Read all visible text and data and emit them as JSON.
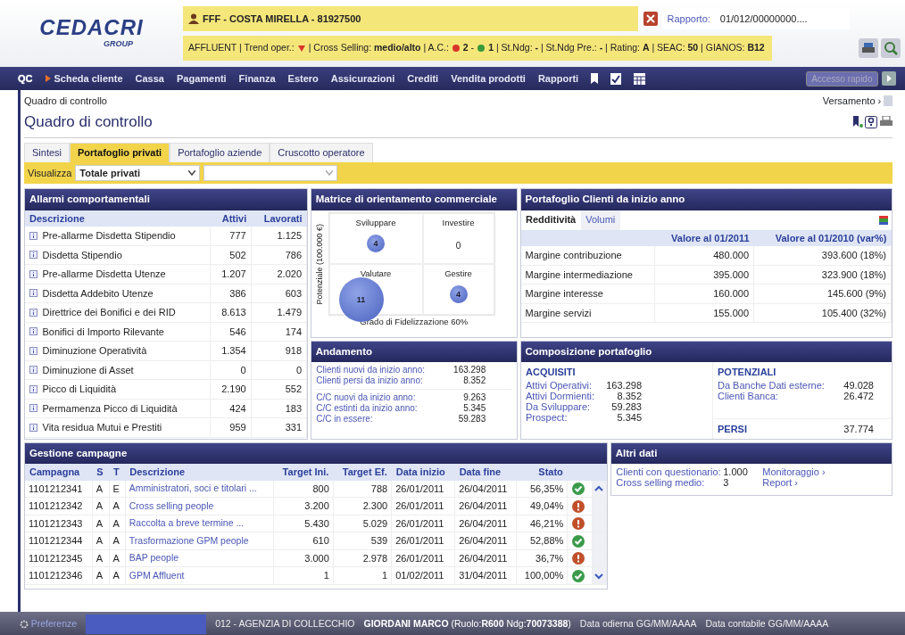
{
  "header": {
    "logo": "CEDACRI",
    "logo_sub": "GROUP",
    "client": "FFF - COSTA MIRELLA - 81927500",
    "rapporto_label": "Rapporto:",
    "rapporto_value": "01/012/00000000....",
    "info_segments": [
      {
        "kind": "text",
        "text": "AFFLUENT | Trend oper.:"
      },
      {
        "kind": "arrow",
        "color": "#d9352b"
      },
      {
        "kind": "text",
        "text": "| Cross Selling: **medio/alto** | A.C.:"
      },
      {
        "kind": "dot",
        "color": "#d9352b"
      },
      {
        "kind": "text",
        "text": "**2** -"
      },
      {
        "kind": "dot",
        "color": "#3a9a3a"
      },
      {
        "kind": "text",
        "text": "**1** | St.Ndg: **-** | St.Ndg Pre.: **-** | Rating: **A** | SEAC: **50** | GIANOS: **B12**"
      }
    ]
  },
  "nav": {
    "items": [
      {
        "label": "QC",
        "selected": true
      },
      {
        "label": "Scheda cliente",
        "selected": false
      },
      {
        "label": "Cassa",
        "selected": false
      },
      {
        "label": "Pagamenti",
        "selected": false
      },
      {
        "label": "Finanza",
        "selected": false
      },
      {
        "label": "Estero",
        "selected": false
      },
      {
        "label": "Assicurazioni",
        "selected": false
      },
      {
        "label": "Crediti",
        "selected": false
      },
      {
        "label": "Vendita prodotti",
        "selected": false
      },
      {
        "label": "Rapporti",
        "selected": false
      }
    ],
    "quick_access": "Accesso rapido"
  },
  "breadcrumb": "Quadro di controllo",
  "page_title": "Quadro di controllo",
  "versamento": "Versamento ›",
  "tabs": [
    {
      "label": "Sintesi",
      "selected": false
    },
    {
      "label": "Portafoglio privati",
      "selected": true
    },
    {
      "label": "Portafoglio aziende",
      "selected": false
    },
    {
      "label": "Cruscotto operatore",
      "selected": false
    }
  ],
  "filter": {
    "label": "Visualizza",
    "value": "Totale privati"
  },
  "alarms": {
    "title": "Allarmi comportamentali",
    "columns": [
      "Descrizione",
      "Attivi",
      "Lavorati"
    ],
    "rows": [
      [
        "Pre-allarme Disdetta Stipendio",
        "777",
        "1.125"
      ],
      [
        "Disdetta Stipendio",
        "502",
        "786"
      ],
      [
        "Pre-allarme Disdetta Utenze",
        "1.207",
        "2.020"
      ],
      [
        "Disdetta Addebito Utenze",
        "386",
        "603"
      ],
      [
        "Direttrice dei Bonifici e dei RID",
        "8.613",
        "1.479"
      ],
      [
        "Bonifici di Importo Rilevante",
        "546",
        "174"
      ],
      [
        "Diminuzione Operatività",
        "1.354",
        "918"
      ],
      [
        "Diminuzione di Asset",
        "0",
        "0"
      ],
      [
        "Picco di Liquidità",
        "2.190",
        "552"
      ],
      [
        "Permamenza Picco di Liquidità",
        "424",
        "183"
      ],
      [
        "Vita residua Mutui e Prestiti",
        "959",
        "331"
      ]
    ]
  },
  "matrix": {
    "title": "Matrice di orientamento commerciale",
    "ylabel": "Potenziale (100.000 €)",
    "xlabel": "Grado di Fidelizzazione 60%",
    "quadrants": [
      {
        "label": "Sviluppare",
        "count": "4",
        "kind": "small"
      },
      {
        "label": "Investire",
        "count": "0",
        "kind": "none"
      },
      {
        "label": "Valutare",
        "count": "11",
        "kind": "large"
      },
      {
        "label": "Gestire",
        "count": "4",
        "kind": "small"
      }
    ]
  },
  "trend": {
    "title": "Andamento",
    "groups": [
      [
        [
          "Clienti nuovi da inizio anno:",
          "163.298"
        ],
        [
          "Clienti persi da inizio anno:",
          "8.352"
        ]
      ],
      [
        [
          "C/C nuovi da inizio anno:",
          "9.263"
        ],
        [
          "C/C estinti da inizio anno:",
          "5.345"
        ],
        [
          "C/C in essere:",
          "59.283"
        ]
      ]
    ]
  },
  "portfolio": {
    "title": "Portafoglio Clienti da inizio anno",
    "tabs": [
      {
        "label": "Redditività",
        "selected": true
      },
      {
        "label": "Volumi",
        "selected": false
      }
    ],
    "columns": [
      "",
      "Valore al 01/2011",
      "Valore al 01/2010 (var%)"
    ],
    "rows": [
      [
        "Margine contribuzione",
        "480.000",
        "393.600 (18%)"
      ],
      [
        "Margine intermediazione",
        "395.000",
        "323.900 (18%)"
      ],
      [
        "Margine interesse",
        "160.000",
        "145.600 (9%)"
      ],
      [
        "Margine servizi",
        "155.000",
        "105.400 (32%)"
      ]
    ]
  },
  "composition": {
    "title": "Composizione portafoglio",
    "acquired_title": "ACQUISITI",
    "acquired": [
      [
        "Attivi Operativi:",
        "163.298"
      ],
      [
        "Attivi Dormienti:",
        "8.352"
      ],
      [
        "Da Sviluppare:",
        "59.283"
      ],
      [
        "Prospect:",
        "5.345"
      ]
    ],
    "potential_title": "POTENZIALI",
    "potential": [
      [
        "Da Banche Dati esterne:",
        "49.028"
      ],
      [
        "Clienti Banca:",
        "26.472"
      ]
    ],
    "lost_label": "PERSI",
    "lost_value": "37.774"
  },
  "campaigns": {
    "title": "Gestione campagne",
    "columns": [
      "Campagna",
      "S",
      "T",
      "Descrizione",
      "Target Ini.",
      "Target Ef.",
      "Data inizio",
      "Data fine",
      "Stato"
    ],
    "rows": [
      {
        "cells": [
          "1101212341",
          "A",
          "E",
          "Amministratori, soci e titolari ...",
          "800",
          "788",
          "26/01/2011",
          "26/04/2011",
          "56,35%"
        ],
        "alert": false
      },
      {
        "cells": [
          "1101212342",
          "A",
          "A",
          "Cross selling people",
          "3.200",
          "2.300",
          "26/01/2011",
          "26/04/2011",
          "49,04%"
        ],
        "alert": true
      },
      {
        "cells": [
          "1101212343",
          "A",
          "A",
          "Raccolta a breve termine ...",
          "5.430",
          "5.029",
          "26/01/2011",
          "26/04/2011",
          "46,21%"
        ],
        "alert": true
      },
      {
        "cells": [
          "1101212344",
          "A",
          "A",
          "Trasformazione GPM people",
          "610",
          "539",
          "26/01/2011",
          "26/04/2011",
          "52,88%"
        ],
        "alert": false
      },
      {
        "cells": [
          "1101212345",
          "A",
          "A",
          "BAP people",
          "3.000",
          "2.978",
          "26/01/2011",
          "26/04/2011",
          "36,7%"
        ],
        "alert": true
      },
      {
        "cells": [
          "1101212346",
          "A",
          "A",
          "GPM Affluent",
          "1",
          "1",
          "01/02/2011",
          "31/04/2011",
          "100,00%"
        ],
        "alert": false
      }
    ]
  },
  "other": {
    "title": "Altri dati",
    "rows": [
      [
        "Clienti con questionario:",
        "1.000"
      ],
      [
        "Cross selling medio:",
        "3"
      ]
    ],
    "links": [
      "Monitoraggio ›",
      "Report ›"
    ]
  },
  "status_bar": {
    "preferences": "Preferenze",
    "agency": "012 - AGENZIA DI COLLECCHIO",
    "operator": "**GIORDANI MARCO** (Ruolo:**R600** Ndg:**70073388**)",
    "today": "Data odierna GG/MM/AAAA",
    "accounting": "Data contabile GG/MM/AAAA"
  }
}
